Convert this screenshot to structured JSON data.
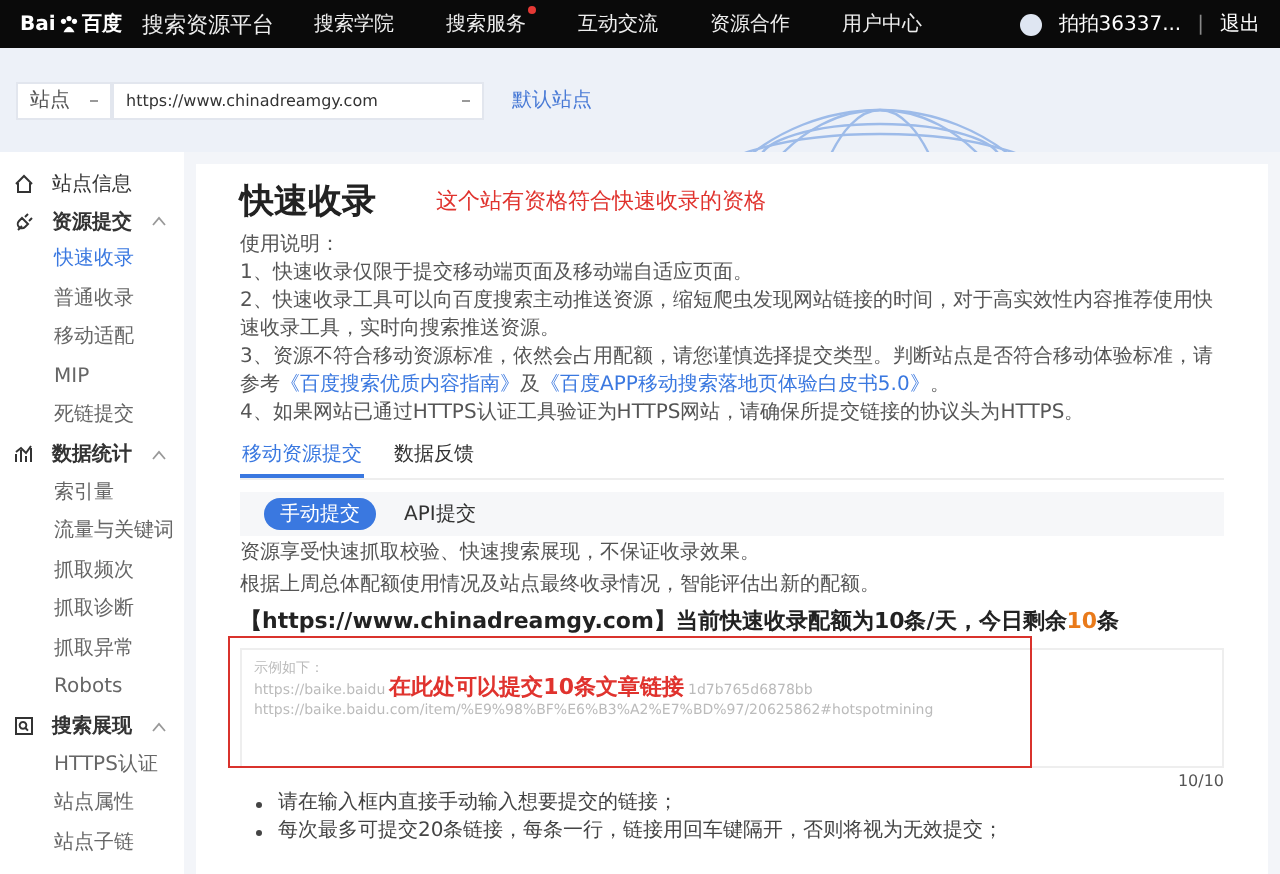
{
  "header": {
    "logo_prefix": "Bai",
    "logo_suffix": "百度",
    "nav": [
      {
        "label": "搜索资源平台",
        "dot": false
      },
      {
        "label": "搜索学院",
        "dot": false
      },
      {
        "label": "搜索服务",
        "dot": true
      },
      {
        "label": "互动交流",
        "dot": false
      },
      {
        "label": "资源合作",
        "dot": false
      },
      {
        "label": "用户中心",
        "dot": false
      }
    ],
    "user": "拍拍36337...",
    "separator": "|",
    "logout": "退出"
  },
  "site_bar": {
    "type_select": "站点",
    "url": "https://www.chinadreamgy.com",
    "default_link": "默认站点"
  },
  "sidebar": [
    {
      "kind": "item",
      "label": "站点信息"
    },
    {
      "kind": "group",
      "label": "资源提交",
      "expanded": true,
      "children": [
        {
          "label": "快速收录",
          "selected": true
        },
        {
          "label": "普通收录",
          "selected": false
        },
        {
          "label": "移动适配",
          "selected": false
        },
        {
          "label": "MIP",
          "selected": false
        },
        {
          "label": "死链提交",
          "selected": false
        }
      ]
    },
    {
      "kind": "group",
      "label": "数据统计",
      "expanded": true,
      "children": [
        {
          "label": "索引量",
          "selected": false
        },
        {
          "label": "流量与关键词",
          "selected": false
        },
        {
          "label": "抓取频次",
          "selected": false
        },
        {
          "label": "抓取诊断",
          "selected": false
        },
        {
          "label": "抓取异常",
          "selected": false
        },
        {
          "label": "Robots",
          "selected": false
        }
      ]
    },
    {
      "kind": "group",
      "label": "搜索展现",
      "expanded": true,
      "children": [
        {
          "label": "HTTPS认证",
          "selected": false
        },
        {
          "label": "站点属性",
          "selected": false
        },
        {
          "label": "站点子链",
          "selected": false
        }
      ]
    }
  ],
  "content": {
    "title": "快速收录",
    "annotation": "这个站有资格符合快速收录的资格",
    "usage_heading": "使用说明：",
    "usage_items": [
      {
        "parts": [
          {
            "kind": "text",
            "text": "1、快速收录仅限于提交移动端页面及移动端自适应页面。"
          }
        ]
      },
      {
        "parts": [
          {
            "kind": "text",
            "text": "2、快速收录工具可以向百度搜索主动推送资源，缩短爬虫发现网站链接的时间，对于高实效性内容推荐使用快速收录工具，实时向搜索推送资源。"
          }
        ]
      },
      {
        "parts": [
          {
            "kind": "text",
            "text": "3、资源不符合移动资源标准，依然会占用配额，请您谨慎选择提交类型。判断站点是否符合移动体验标准，请参考"
          },
          {
            "kind": "link",
            "text": "《百度搜索优质内容指南》"
          },
          {
            "kind": "text",
            "text": "及"
          },
          {
            "kind": "link",
            "text": "《百度APP移动搜索落地页体验白皮书5.0》"
          },
          {
            "kind": "text",
            "text": "。"
          }
        ]
      },
      {
        "parts": [
          {
            "kind": "text",
            "text": "4、如果网站已通过HTTPS认证工具验证为HTTPS网站，请确保所提交链接的协议头为HTTPS。"
          }
        ]
      }
    ],
    "tabs": [
      {
        "label": "移动资源提交",
        "selected": true
      },
      {
        "label": "数据反馈",
        "selected": false
      }
    ],
    "subtabs": [
      {
        "label": "手动提交",
        "selected": true
      },
      {
        "label": "API提交",
        "selected": false
      }
    ],
    "notes": [
      "资源享受快速抓取校验、快速搜索展现，不保证收录效果。",
      "根据上周总体配额使用情况及站点最终收录情况，智能评估出新的配额。"
    ],
    "quota": {
      "text": "【https://www.chinadreamgy.com】当前快速收录配额为10条/天，今日剩余",
      "remaining": "10",
      "unit": "条"
    },
    "input": {
      "placeholder_heading": "示例如下：",
      "line_2_left": "https://baike.baidu",
      "line_2_right": "1d7b765d6878bb",
      "line_3": "https://baike.baidu.com/item/%E9%98%BF%E6%B3%A2%E7%BD%97/20625862#hotspotmining",
      "annotation": "在此处可以提交10条文章链接",
      "counter": "10/10"
    },
    "bullets": [
      "请在输入框内直接手动输入想要提交的链接；",
      "每次最多可提交20条链接，每条一行，链接用回车键隔开，否则将视为无效提交；"
    ]
  }
}
